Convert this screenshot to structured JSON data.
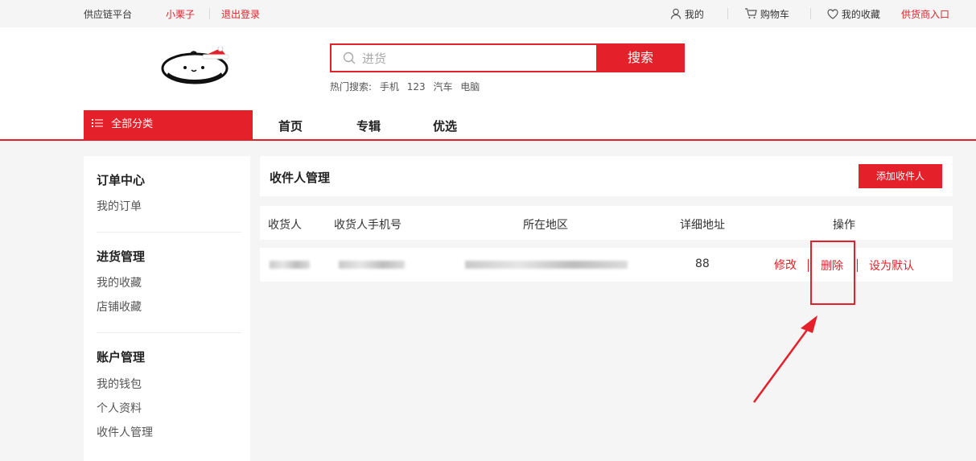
{
  "topbar": {
    "platform": "供应链平台",
    "username": "小栗子",
    "logout": "退出登录",
    "mine": "我的",
    "cart": "购物车",
    "favorites": "我的收藏",
    "supplier_entry": "供货商入口"
  },
  "search": {
    "placeholder": "进货",
    "button": "搜索",
    "hot_label": "热门搜索:",
    "hot_terms": [
      "手机",
      "123",
      "汽车",
      "电脑"
    ]
  },
  "nav": {
    "all_categories": "全部分类",
    "items": [
      "首页",
      "专辑",
      "优选"
    ]
  },
  "sidebar": {
    "sections": [
      {
        "title": "订单中心",
        "items": [
          "我的订单"
        ]
      },
      {
        "title": "进货管理",
        "items": [
          "我的收藏",
          "店铺收藏"
        ]
      },
      {
        "title": "账户管理",
        "items": [
          "我的钱包",
          "个人资料",
          "收件人管理"
        ]
      }
    ],
    "active": "收件人管理"
  },
  "panel": {
    "title": "收件人管理",
    "add_button": "添加收件人",
    "columns": [
      "收货人",
      "收货人手机号",
      "所在地区",
      "详细地址",
      "操作"
    ],
    "rows": [
      {
        "detail_address": "88",
        "actions": [
          "修改",
          "删除",
          "设为默认"
        ]
      }
    ]
  },
  "colors": {
    "accent": "#e4212a"
  }
}
